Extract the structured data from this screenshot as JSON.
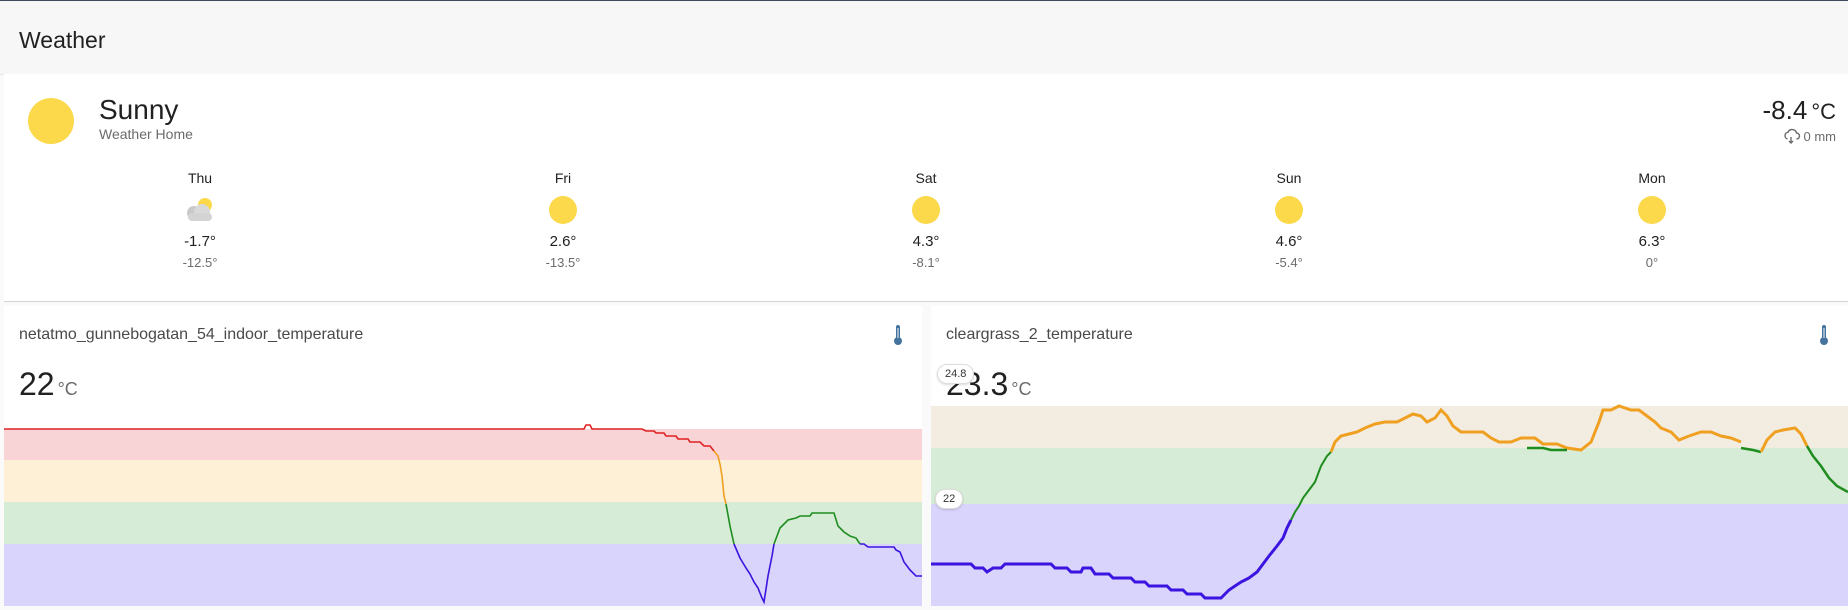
{
  "header": {
    "title": "Weather"
  },
  "current": {
    "condition": "Sunny",
    "entity_name": "Weather Home",
    "temperature": "-8.4",
    "unit": "°C",
    "precipitation": "0 mm",
    "icon": "sun-icon"
  },
  "forecast": [
    {
      "day": "Thu",
      "icon": "partly-cloudy-icon",
      "high": "-1.7°",
      "low": "-12.5°"
    },
    {
      "day": "Fri",
      "icon": "sun-icon",
      "high": "2.6°",
      "low": "-13.5°"
    },
    {
      "day": "Sat",
      "icon": "sun-icon",
      "high": "4.3°",
      "low": "-8.1°"
    },
    {
      "day": "Sun",
      "icon": "sun-icon",
      "high": "4.6°",
      "low": "-5.4°"
    },
    {
      "day": "Mon",
      "icon": "sun-icon",
      "high": "6.3°",
      "low": "0°"
    }
  ],
  "sensors": [
    {
      "name": "netatmo_gunnebogatan_54_indoor_temperature",
      "value": "22",
      "unit": "°C",
      "icon": "thermometer-icon"
    },
    {
      "name": "cleargrass_2_temperature",
      "value": "23.3",
      "unit": "°C",
      "icon": "thermometer-icon",
      "max_label": "24.8",
      "min_label": "22"
    }
  ],
  "colors": {
    "sun": "#fbd94a",
    "band_red": "#f8d4d6",
    "band_yellow": "#fdf0d6",
    "band_green": "#d6ecd6",
    "band_purple": "#d8d4fb",
    "line_red": "#e02020",
    "line_orange": "#f0a020",
    "line_green": "#1e8c1e",
    "line_purple": "#3c14e0"
  }
}
